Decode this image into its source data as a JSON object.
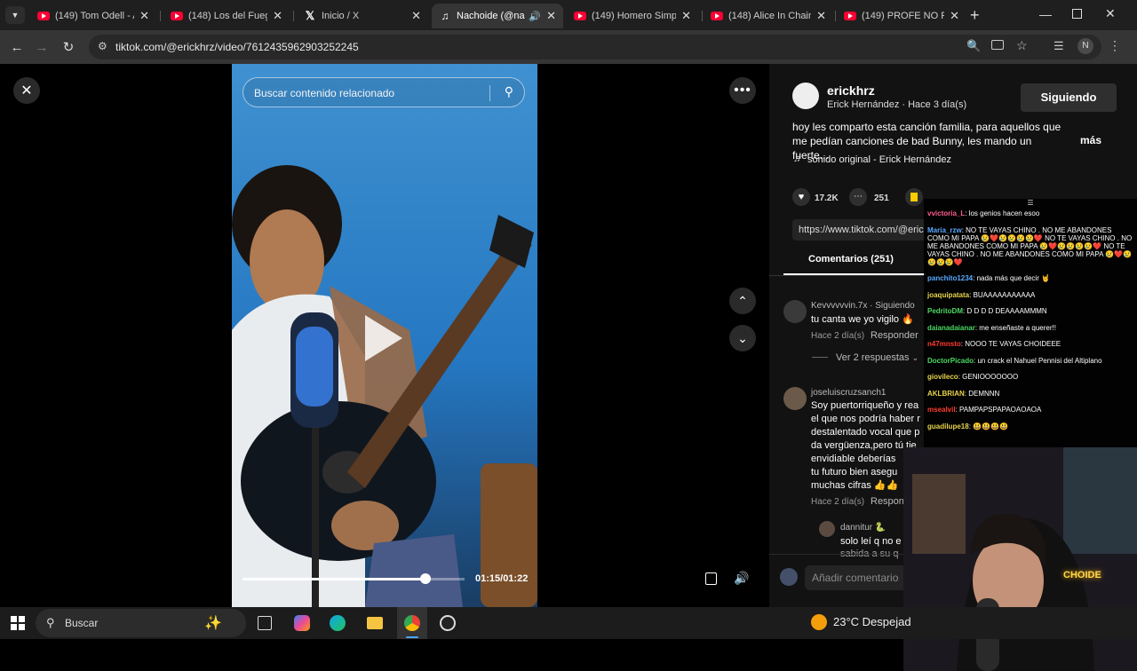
{
  "tabs": [
    {
      "title": "(149) Tom Odell - An",
      "icon": "youtube-icon"
    },
    {
      "title": "(148) Los del Fuego",
      "icon": "youtube-icon"
    },
    {
      "title": "Inicio / X",
      "icon": "x-logo-icon"
    },
    {
      "title": "Nachoide (@nac",
      "icon": "tiktok-icon",
      "active": true
    },
    {
      "title": "(149) Homero Simps",
      "icon": "youtube-icon"
    },
    {
      "title": "(148) Alice In Chains",
      "icon": "youtube-icon"
    },
    {
      "title": "(149) PROFE NO PIT",
      "icon": "youtube-icon"
    }
  ],
  "address": {
    "url": "tiktok.com/@erickhrz/video/7612435962903252245",
    "profile_initial": "N"
  },
  "video": {
    "search_placeholder": "Buscar contenido relacionado",
    "time": "01:15/01:22",
    "progress": 0.917
  },
  "post": {
    "username": "erickhrz",
    "byline": "Erick Hernández · Hace 3 día(s)",
    "follow_label": "Siguiendo",
    "caption": "hoy les comparto esta canción familia, para aquellos que me pedían canciones de bad Bunny, les mando un fuerte...",
    "more_label": "más",
    "sound": "sonido original - Erick Hernández",
    "likes": "17.2K",
    "comments_count": "251",
    "link": "https://www.tiktok.com/@eric",
    "comments_tab": "Comentarios (251)"
  },
  "comments": [
    {
      "user": "Kevvvvvvin.7x · Siguiendo",
      "text": "tu canta we yo vigilo 🔥",
      "meta": "Hace 2 día(s)",
      "reply": "Responder",
      "replies_label": "Ver 2 respuestas"
    },
    {
      "user": "joseluiscruzsanch1",
      "lines": [
        "Soy puertorriqueño y rea",
        "el que nos podría haber r",
        "destalentado vocal que p",
        "da vergüenza,pero tú tie",
        "envidiable deberías",
        "tu futuro bien asegu",
        "muchas cifras 👍👍"
      ],
      "meta": "Hace 2 día(s)",
      "reply": "Respon"
    },
    {
      "user": "dannitur 🐍",
      "lines": [
        "solo leí q no e",
        "sabida a su q"
      ]
    }
  ],
  "add_comment_placeholder": "Añadir comentario",
  "chat": [
    {
      "user": "vvictoria_L",
      "color": "#ff5d8f",
      "text": "los genios hacen esoo"
    },
    {
      "user": "Maria_rzw",
      "color": "#5aa9ff",
      "text": "NO TE VAYAS CHINO . NO ME ABANDONES COMO MI PAPA 😢❤️😢😢😢😢❤️ NO TE VAYAS CHINO . NO ME ABANDONES COMO MI PAPA 😢❤️😢😢😢😢❤️ NO TE VAYAS CHINO . NO ME ABANDONES COMO MI PAPA 😢❤️😢😢😢😢❤️"
    },
    {
      "user": "panchito1234",
      "color": "#5aa9ff",
      "text": "nada más que decir 🤘"
    },
    {
      "user": "joaquipatata",
      "color": "#e8d44d",
      "text": "BUAAAAAAAAAAA"
    },
    {
      "user": "PedritoDM",
      "color": "#4cd964",
      "text": "D D D D DEAAAAMMMN"
    },
    {
      "user": "daianadaianar",
      "color": "#4cd964",
      "text": "me enseñaste a querer!!"
    },
    {
      "user": "n47mnsto",
      "color": "#ff3b30",
      "text": "NOOO TE VAYAS CHOIDEEE"
    },
    {
      "user": "DoctorPicado",
      "color": "#4cd964",
      "text": "un crack el Nahuel Pennisi del Altiplano"
    },
    {
      "user": "giovileco",
      "color": "#e8d44d",
      "text": "GENIOOOOOOO"
    },
    {
      "user": "AKLBRIAN",
      "color": "#e8d44d",
      "text": "DEMNNN"
    },
    {
      "user": "msealvil",
      "color": "#ff3b30",
      "text": "PAMPAPSPAPAOAOAOA"
    },
    {
      "user": "guadilupe18",
      "color": "#e8d44d",
      "text": "😃😃😃😃"
    }
  ],
  "webcam_sign": "CHOIDE",
  "taskbar": {
    "search_placeholder": "Buscar",
    "weather": "23°C Despejad"
  },
  "colors": {
    "tiktok_red": "#fe2c55",
    "youtube_red": "#ff0033",
    "bookmark_yellow": "#facd00"
  }
}
